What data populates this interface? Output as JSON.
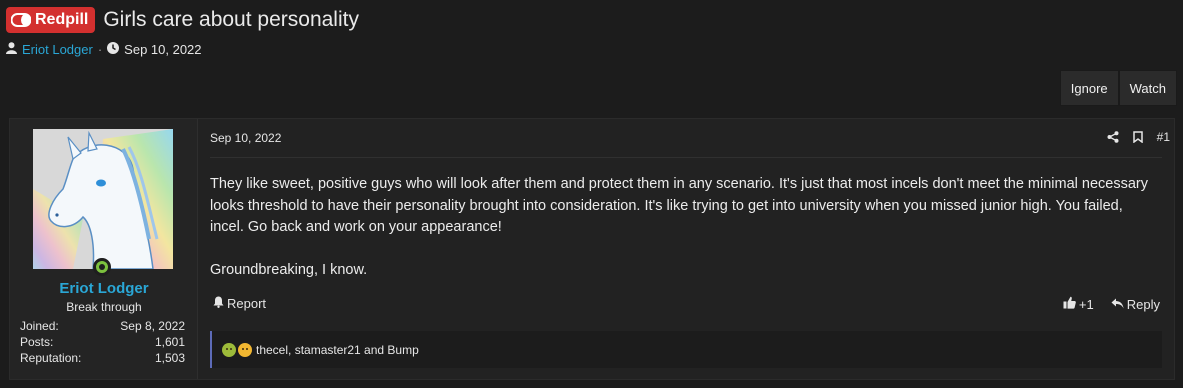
{
  "thread": {
    "prefix": "Redpill",
    "title": "Girls care about personality",
    "author": "Eriot Lodger",
    "separator": "·",
    "date": "Sep 10, 2022"
  },
  "thread_actions": {
    "ignore": "Ignore",
    "watch": "Watch"
  },
  "post": {
    "user": {
      "name": "Eriot Lodger",
      "title": "Break through",
      "stats": [
        {
          "label": "Joined:",
          "value": "Sep 8, 2022"
        },
        {
          "label": "Posts:",
          "value": "1,601"
        },
        {
          "label": "Reputation:",
          "value": "1,503"
        }
      ]
    },
    "date": "Sep 10, 2022",
    "number": "#1",
    "body": [
      "They like sweet, positive guys who will look after them and protect them in any scenario. It's just that most incels don't meet the minimal necessary looks threshold to have their personality brought into consideration. It's like trying to get into university when you missed junior high. You failed, incel. Go back and work on your appearance!",
      "Groundbreaking, I know."
    ],
    "report": "Report",
    "like_count": "+1",
    "reply": "Reply",
    "reactions_text": "thecel, stamaster21 and Bump"
  },
  "colors": {
    "prefix_badge": "#d3302f",
    "link": "#2aa7d6",
    "online": "#7cc13e",
    "reaction_bar_accent": "#5d6bb8"
  }
}
